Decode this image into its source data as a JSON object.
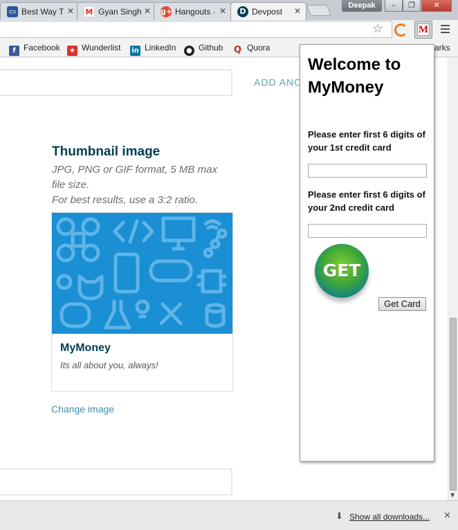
{
  "tabs": [
    {
      "label": "Best Way T",
      "icon": "window-icon",
      "color": "#2b579a"
    },
    {
      "label": "Gyan Singh",
      "icon": "gmail-icon",
      "color": "#d93025"
    },
    {
      "label": "Hangouts ·",
      "icon": "google-plus-icon",
      "color": "#dd4b39"
    },
    {
      "label": "Devpost",
      "icon": "devpost-icon",
      "color": "#003e54",
      "active": true
    }
  ],
  "window": {
    "user": "Deepak",
    "minimize": "–",
    "restore": "❐",
    "close": "✕"
  },
  "bookmarks": [
    {
      "label": "Facebook",
      "icon": "facebook-icon",
      "glyph": "f",
      "color": "#3b5998"
    },
    {
      "label": "Wunderlist",
      "icon": "wunderlist-icon",
      "glyph": "★",
      "color": "#d9342b"
    },
    {
      "label": "LinkedIn",
      "icon": "linkedin-icon",
      "glyph": "in",
      "color": "#0e76a8"
    },
    {
      "label": "Github",
      "icon": "github-icon",
      "glyph": "●",
      "color": "#222222"
    },
    {
      "label": "Quora",
      "icon": "quora-icon",
      "glyph": "Q",
      "color": "#b92b27"
    }
  ],
  "bookmarks_overflow": "marks",
  "page": {
    "add_another": "ADD ANOTHER",
    "thumbnail_title": "Thumbnail image",
    "hint_line1": "JPG, PNG or GIF format, 5 MB max",
    "hint_line2": "file size.",
    "hint_line3": "For best results, use a 3:2 ratio.",
    "card_title": "MyMoney",
    "card_tagline": "Its all about you, always!",
    "change_image": "Change image"
  },
  "downloads": {
    "show_all": "Show all downloads..."
  },
  "popup": {
    "title": "Welcome to MyMoney",
    "label1": "Please enter first 6 digits of your 1st credit card",
    "input1_value": "",
    "label2": "Please enter first 6 digits of your 2nd credit card",
    "input2_value": "",
    "get_icon_text": "GET",
    "button": "Get Card"
  },
  "colors": {
    "accent_teal": "#5aa5b0",
    "devpost_navy": "#003e54",
    "thumbnail_blue": "#1a8fd3"
  }
}
